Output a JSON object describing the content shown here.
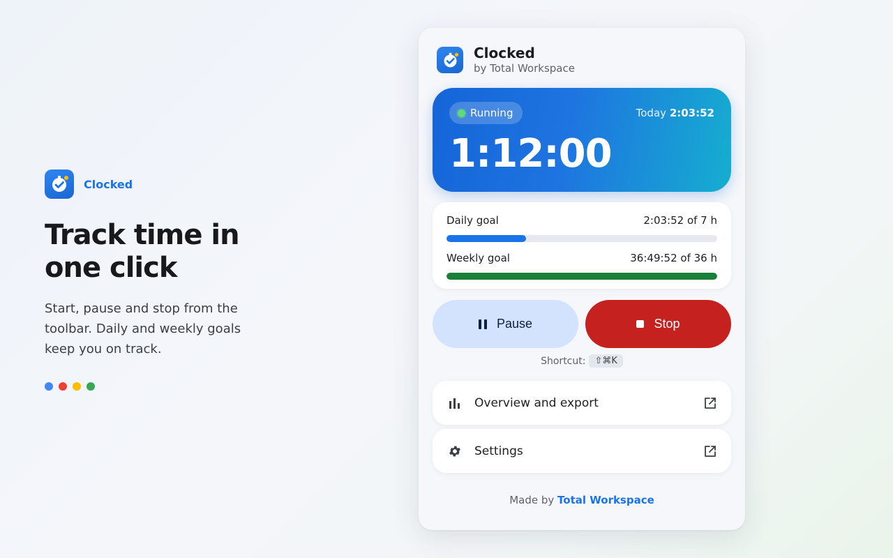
{
  "promo": {
    "brand_name": "Clocked",
    "headline_line1": "Track time in",
    "headline_line2": "one click",
    "description": "Start, pause and stop from the toolbar. Daily and weekly goals keep you on track.",
    "dot_colors": [
      "#4285f4",
      "#ea4335",
      "#fbbc04",
      "#34a853"
    ]
  },
  "popup": {
    "title": "Clocked",
    "subtitle": "by Total Workspace",
    "timer": {
      "status": "Running",
      "today_label": "Today",
      "today_value": "2:03:52",
      "elapsed": "1:12:00"
    },
    "goals": [
      {
        "label": "Daily goal",
        "value": "2:03:52 of 7 h",
        "progress": 0.295,
        "color": "#1a73e8"
      },
      {
        "label": "Weekly goal",
        "value": "36:49:52 of 36 h",
        "progress": 1.0,
        "color": "#188038"
      }
    ],
    "buttons": {
      "pause": "Pause",
      "stop": "Stop"
    },
    "shortcut": {
      "label": "Shortcut:",
      "keys": "⇧⌘K"
    },
    "links": [
      {
        "label": "Overview and export",
        "icon": "bar-chart-icon"
      },
      {
        "label": "Settings",
        "icon": "gear-icon"
      }
    ],
    "footer": {
      "prefix": "Made by",
      "link": "Total Workspace"
    }
  },
  "colors": {
    "accent": "#1a73e8",
    "stop": "#c5221f",
    "pause_bg": "#d3e3fd",
    "running_dot": "#5fd97a"
  }
}
